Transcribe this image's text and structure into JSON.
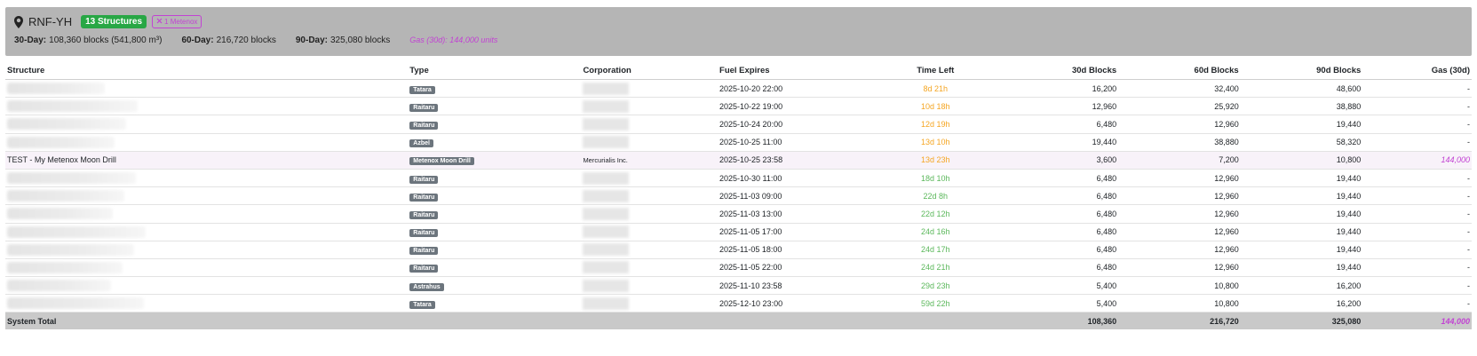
{
  "system": {
    "name": "RNF-YH",
    "structures_badge": "13 Structures",
    "metenox_badge": "1 Metenox",
    "stats": [
      {
        "label": "30-Day:",
        "value": "108,360 blocks (541,800 m³)"
      },
      {
        "label": "60-Day:",
        "value": "216,720 blocks"
      },
      {
        "label": "90-Day:",
        "value": "325,080 blocks"
      }
    ],
    "gas": "Gas (30d): 144,000 units"
  },
  "table": {
    "headers": [
      "Structure",
      "Type",
      "Corporation",
      "Fuel Expires",
      "Time Left",
      "30d Blocks",
      "60d Blocks",
      "90d Blocks",
      "Gas (30d)"
    ],
    "rows": [
      {
        "structure": "",
        "type": "Tatara",
        "corp": "",
        "expires": "2025-10-20 22:00",
        "left": "8d 21h",
        "left_color": "orange",
        "b30": "16,200",
        "b60": "32,400",
        "b90": "48,600",
        "gas": "-"
      },
      {
        "structure": "",
        "type": "Raitaru",
        "corp": "",
        "expires": "2025-10-22 19:00",
        "left": "10d 18h",
        "left_color": "orange",
        "b30": "12,960",
        "b60": "25,920",
        "b90": "38,880",
        "gas": "-"
      },
      {
        "structure": "",
        "type": "Raitaru",
        "corp": "",
        "expires": "2025-10-24 20:00",
        "left": "12d 19h",
        "left_color": "orange",
        "b30": "6,480",
        "b60": "12,960",
        "b90": "19,440",
        "gas": "-"
      },
      {
        "structure": "",
        "type": "Azbel",
        "corp": "",
        "expires": "2025-10-25 11:00",
        "left": "13d 10h",
        "left_color": "orange",
        "b30": "19,440",
        "b60": "38,880",
        "b90": "58,320",
        "gas": "-"
      },
      {
        "structure": "TEST - My Metenox Moon Drill",
        "type": "Metenox Moon Drill",
        "corp": "Mercurialis Inc.",
        "expires": "2025-10-25 23:58",
        "left": "13d 23h",
        "left_color": "orange",
        "b30": "3,600",
        "b60": "7,200",
        "b90": "10,800",
        "gas": "144,000",
        "metenox": true
      },
      {
        "structure": "",
        "type": "Raitaru",
        "corp": "",
        "expires": "2025-10-30 11:00",
        "left": "18d 10h",
        "left_color": "green",
        "b30": "6,480",
        "b60": "12,960",
        "b90": "19,440",
        "gas": "-"
      },
      {
        "structure": "",
        "type": "Raitaru",
        "corp": "",
        "expires": "2025-11-03 09:00",
        "left": "22d 8h",
        "left_color": "green",
        "b30": "6,480",
        "b60": "12,960",
        "b90": "19,440",
        "gas": "-"
      },
      {
        "structure": "",
        "type": "Raitaru",
        "corp": "",
        "expires": "2025-11-03 13:00",
        "left": "22d 12h",
        "left_color": "green",
        "b30": "6,480",
        "b60": "12,960",
        "b90": "19,440",
        "gas": "-"
      },
      {
        "structure": "",
        "type": "Raitaru",
        "corp": "",
        "expires": "2025-11-05 17:00",
        "left": "24d 16h",
        "left_color": "green",
        "b30": "6,480",
        "b60": "12,960",
        "b90": "19,440",
        "gas": "-"
      },
      {
        "structure": "",
        "type": "Raitaru",
        "corp": "",
        "expires": "2025-11-05 18:00",
        "left": "24d 17h",
        "left_color": "green",
        "b30": "6,480",
        "b60": "12,960",
        "b90": "19,440",
        "gas": "-"
      },
      {
        "structure": "",
        "type": "Raitaru",
        "corp": "",
        "expires": "2025-11-05 22:00",
        "left": "24d 21h",
        "left_color": "green",
        "b30": "6,480",
        "b60": "12,960",
        "b90": "19,440",
        "gas": "-"
      },
      {
        "structure": "",
        "type": "Astrahus",
        "corp": "",
        "expires": "2025-11-10 23:58",
        "left": "29d 23h",
        "left_color": "green",
        "b30": "5,400",
        "b60": "10,800",
        "b90": "16,200",
        "gas": "-"
      },
      {
        "structure": "",
        "type": "Tatara",
        "corp": "",
        "expires": "2025-12-10 23:00",
        "left": "59d 22h",
        "left_color": "green",
        "b30": "5,400",
        "b60": "10,800",
        "b90": "16,200",
        "gas": "-"
      }
    ],
    "total": {
      "label": "System Total",
      "b30": "108,360",
      "b60": "216,720",
      "b90": "325,080",
      "gas": "144,000"
    }
  },
  "colors": {
    "orange": "#f5a623",
    "green": "#5cb85c",
    "purple": "#c242d3",
    "badge_green": "#28a745",
    "type_badge": "#6c757d",
    "header_bg": "#b5b5b5"
  }
}
